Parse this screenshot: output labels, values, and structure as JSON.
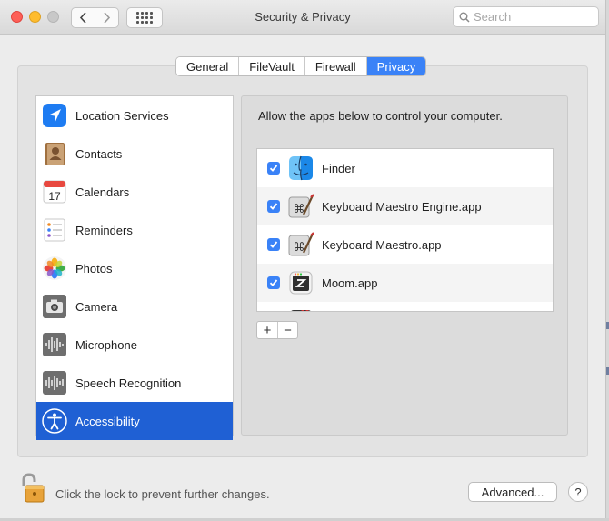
{
  "window": {
    "title": "Security & Privacy"
  },
  "search": {
    "placeholder": "Search",
    "value": "",
    "icon": "search-icon"
  },
  "tabs": [
    {
      "label": "General",
      "active": false
    },
    {
      "label": "FileVault",
      "active": false
    },
    {
      "label": "Firewall",
      "active": false
    },
    {
      "label": "Privacy",
      "active": true
    }
  ],
  "sidebar": {
    "items": [
      {
        "label": "Location Services",
        "icon": "location-arrow-icon",
        "selected": false
      },
      {
        "label": "Contacts",
        "icon": "contacts-book-icon",
        "selected": false
      },
      {
        "label": "Calendars",
        "icon": "calendar-icon",
        "selected": false,
        "icon_text": "17"
      },
      {
        "label": "Reminders",
        "icon": "reminders-list-icon",
        "selected": false
      },
      {
        "label": "Photos",
        "icon": "photos-flower-icon",
        "selected": false
      },
      {
        "label": "Camera",
        "icon": "camera-icon",
        "selected": false
      },
      {
        "label": "Microphone",
        "icon": "microphone-waveform-icon",
        "selected": false
      },
      {
        "label": "Speech Recognition",
        "icon": "speech-waveform-icon",
        "selected": false
      },
      {
        "label": "Accessibility",
        "icon": "accessibility-person-icon",
        "selected": true
      }
    ]
  },
  "main": {
    "description": "Allow the apps below to control your computer.",
    "apps": [
      {
        "name": "Finder",
        "checked": true,
        "icon": "finder-icon"
      },
      {
        "name": "Keyboard Maestro Engine.app",
        "checked": true,
        "icon": "keyboard-maestro-icon"
      },
      {
        "name": "Keyboard Maestro.app",
        "checked": true,
        "icon": "keyboard-maestro-icon"
      },
      {
        "name": "Moom.app",
        "checked": true,
        "icon": "moom-icon"
      }
    ],
    "add_label": "+",
    "remove_label": "−"
  },
  "footer": {
    "lock_text": "Click the lock to prevent further changes.",
    "advanced_label": "Advanced...",
    "help_label": "?"
  },
  "colors": {
    "accent": "#3a82f7",
    "selection": "#1f60d4",
    "close": "#fd5f57",
    "minimize": "#febc2e"
  }
}
